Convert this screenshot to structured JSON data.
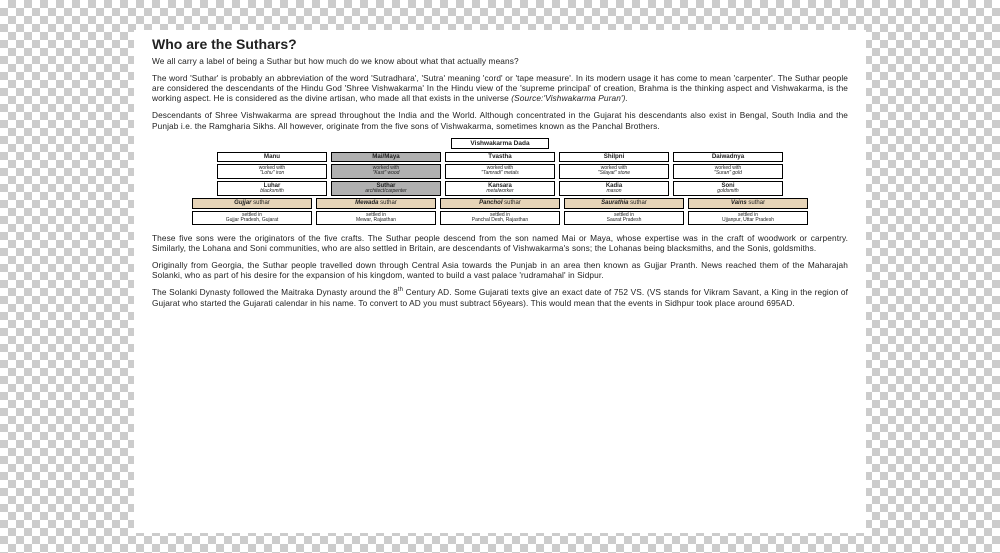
{
  "title": "Who are the Suthars?",
  "para1": "We all carry a label of being a Suthar but how much do we know about what that actually means?",
  "para2a": "The word 'Suthar' is probably an abbreviation of the word 'Sutradhara', 'Sutra' meaning 'cord' or 'tape measure'. In its modern usage it has come to mean 'carpenter'. The Suthar people are considered the descendants of the Hindu God 'Shree Vishwakarma' In the Hindu view of the 'supreme principal' of creation, Brahma is the thinking aspect and Vishwakarma, is the working aspect. He is considered as the divine artisan, who made all that exists in the universe ",
  "para2b": "(Source:'Vishwakarma Puran').",
  "para3": "Descendants of Shree Vishwakarma are spread throughout the India and the World. Although concentrated in the Gujarat his descendants also exist in Bengal, South India and the Punjab i.e. the Ramgharia Sikhs. All however, originate from the five sons of Vishwakarma, sometimes known as the Panchal Brothers.",
  "para4": "These five sons were the originators of the five crafts. The Suthar people descend from the son named Mai or Maya, whose expertise was in the craft of woodwork or carpentry. Similarly, the Lohana and Soni communities, who are also settled in Britain, are descendants of Vishwakarma's sons; the Lohanas being blacksmiths, and the Sonis, goldsmiths.",
  "para5": "Originally from Georgia, the Suthar people travelled down through Central Asia towards the Punjab in an area then known as Gujjar Pranth. News reached them of the Maharajah Solanki, who as part of his desire for the expansion of his kingdom, wanted to build a vast palace 'rudramahal' in Sidpur.",
  "para6a": "The Solanki Dynasty followed the Maitraka Dynasty around the 8",
  "para6sup": "th",
  "para6b": " Century AD. Some Gujarati texts give an exact date of 752 VS. (VS stands for Vikram Savant, a King in the region of Gujarat who started the Gujarati calendar in his name. To convert to AD you must subtract 56years). This would mean that the events in Sidhpur took place around 695AD.",
  "chart": {
    "root": "Vishwakarma Dada",
    "sons": [
      {
        "name": "Manu",
        "hi": false
      },
      {
        "name": "Mai/Maya",
        "hi": true
      },
      {
        "name": "Tvastha",
        "hi": false
      },
      {
        "name": "Shilpni",
        "hi": false
      },
      {
        "name": "Daiwadnya",
        "hi": false
      }
    ],
    "work": [
      {
        "l1": "worked with",
        "l2": "\"Lohu\" iron",
        "hi": false
      },
      {
        "l1": "worked with",
        "l2": "\"Kast\" wood",
        "hi": true
      },
      {
        "l1": "worked with",
        "l2": "\"Tamradi\" metals",
        "hi": false
      },
      {
        "l1": "worked with",
        "l2": "\"Silayat\" stone",
        "hi": false
      },
      {
        "l1": "worked with",
        "l2": "\"Suran\" gold",
        "hi": false
      }
    ],
    "occ": [
      {
        "l1": "Luhar",
        "l2": "blacksmith",
        "hi": false
      },
      {
        "l1": "Suthar",
        "l2": "architect/carpenter",
        "hi": true
      },
      {
        "l1": "Kansara",
        "l2": "metalworker",
        "hi": false
      },
      {
        "l1": "Kadia",
        "l2": "mason",
        "hi": false
      },
      {
        "l1": "Soni",
        "l2": "goldsmith",
        "hi": false
      }
    ],
    "suthar": [
      {
        "b": "Gujjar",
        "t": " suthar"
      },
      {
        "b": "Mewada",
        "t": " suthar"
      },
      {
        "b": "Panchol",
        "t": " suthar"
      },
      {
        "b": "Saurathia",
        "t": " suthar"
      },
      {
        "b": "Vains",
        "t": " suthar"
      }
    ],
    "settle": [
      {
        "l1": "settled in",
        "l2": "Gujjar Pradesh, Gujarat"
      },
      {
        "l1": "settled in",
        "l2": "Mewar, Rajasthan"
      },
      {
        "l1": "settled in",
        "l2": "Panchal Desh, Rajasthan"
      },
      {
        "l1": "settled in",
        "l2": "Saurat Pradesh"
      },
      {
        "l1": "settled in",
        "l2": "Ujjanpur, Uttar Pradesh"
      }
    ]
  }
}
